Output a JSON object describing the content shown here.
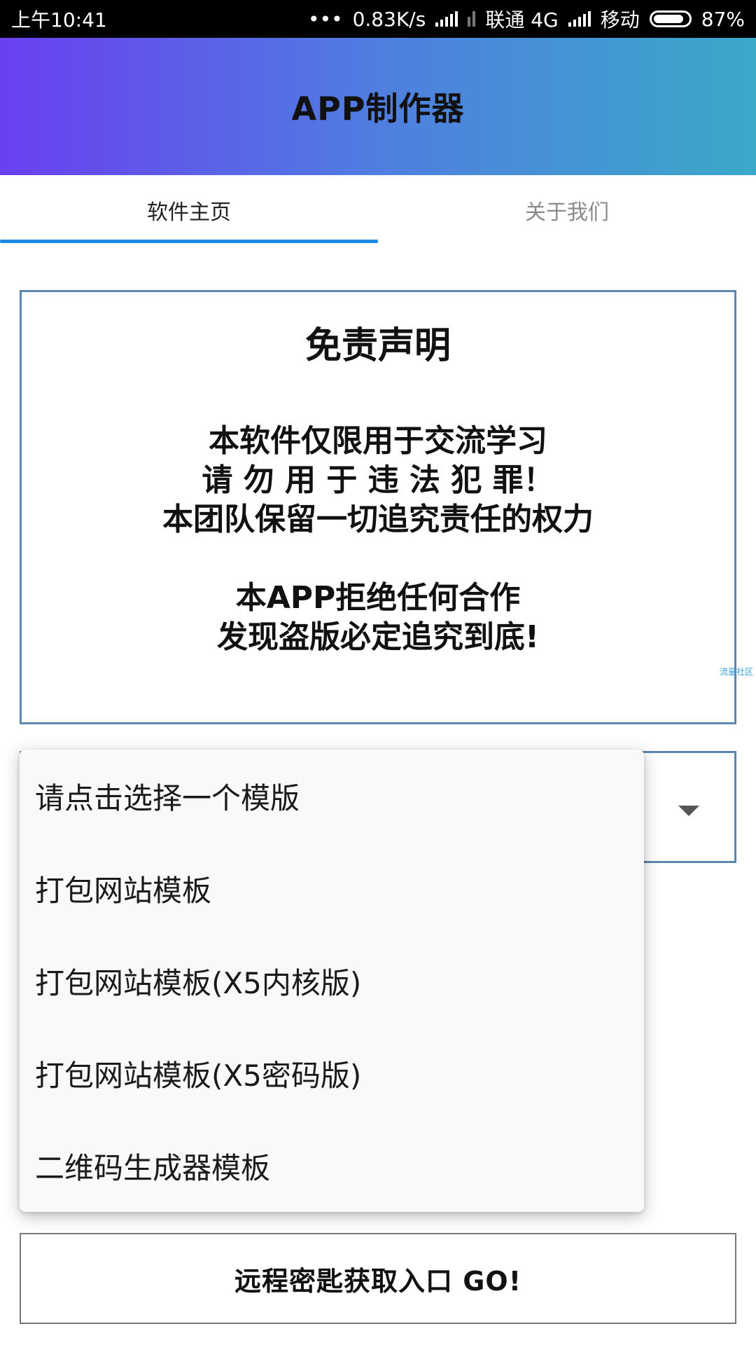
{
  "status_bar": {
    "time": "上午10:41",
    "dots": "•••",
    "speed": "0.83K/s",
    "carrier1": "联通 4G",
    "carrier2": "移动",
    "battery": "87%",
    "battery_level": 0.87
  },
  "header": {
    "title": "APP制作器"
  },
  "tabs": [
    {
      "label": "软件主页",
      "active": true
    },
    {
      "label": "关于我们",
      "active": false
    }
  ],
  "disclaimer": {
    "title": "免责声明",
    "lines": [
      "本软件仅限用于交流学习",
      "请 勿 用 于 违 法 犯 罪！",
      "本团队保留一切追究责任的权力",
      "本APP拒绝任何合作",
      "发现盗版必定追究到底!"
    ]
  },
  "watermark": "流量社区",
  "dropdown": {
    "options": [
      "请点击选择一个模版",
      "打包网站模板",
      "打包网站模板(X5内核版)",
      "打包网站模板(X5密码版)",
      "二维码生成器模板"
    ]
  },
  "go_button": {
    "label": "远程密匙获取入口  GO!"
  },
  "colors": {
    "header_gradient_start": "#6a3ff0",
    "header_gradient_end": "#3aa8c8",
    "tab_indicator": "#1e88e5",
    "card_border": "#5d86b0"
  }
}
